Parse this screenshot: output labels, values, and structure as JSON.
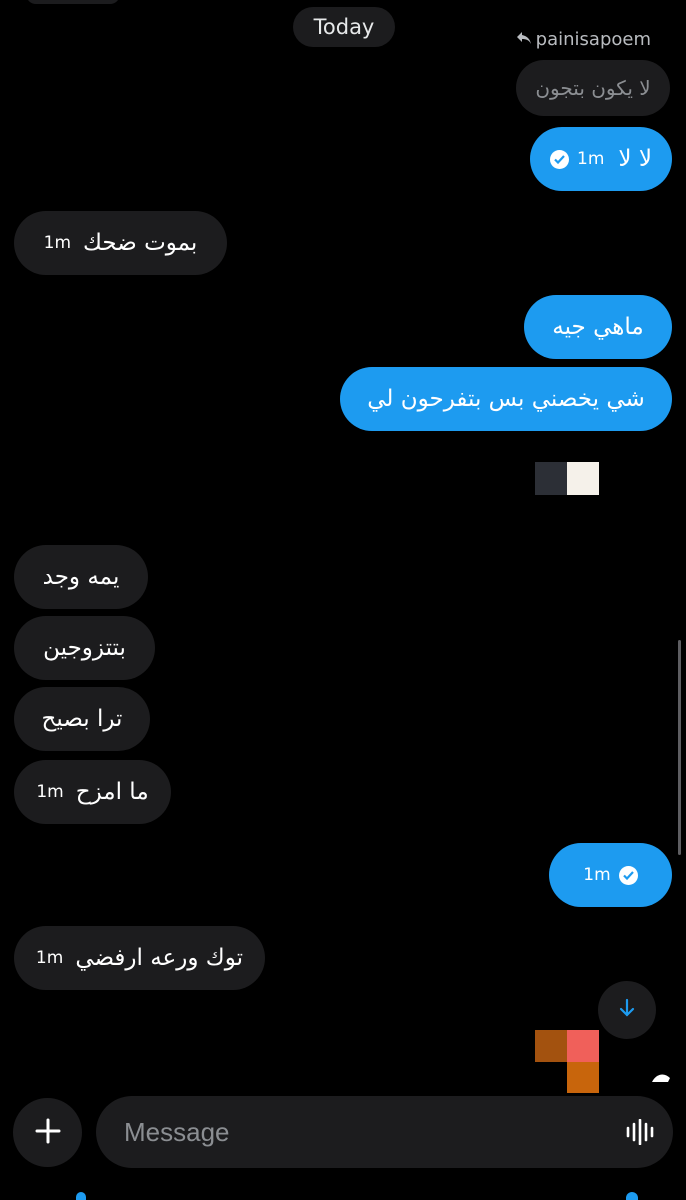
{
  "header": {
    "date_label": "Today",
    "reply_to_handle": "painisapoem",
    "reply_quote_text": "لا يكون بتجون"
  },
  "messages": [
    {
      "id": "m1",
      "direction": "outgoing",
      "text": "لا لا",
      "time": "1m",
      "status_icon": "check-circle-icon"
    },
    {
      "id": "m2",
      "direction": "incoming",
      "text": "بموت ضحك",
      "time": "1m"
    },
    {
      "id": "m3",
      "direction": "outgoing",
      "text": "ماهي جيه"
    },
    {
      "id": "m4",
      "direction": "outgoing",
      "text": "شي يخصني بس بتفرحون لي"
    },
    {
      "id": "m5",
      "direction": "incoming",
      "text": "يمه وجد"
    },
    {
      "id": "m6",
      "direction": "incoming",
      "text": "بتتزوجين"
    },
    {
      "id": "m7",
      "direction": "incoming",
      "text": "ترا بصيح"
    },
    {
      "id": "m8",
      "direction": "incoming",
      "text": "ما امزح",
      "time": "1m"
    },
    {
      "id": "m9",
      "direction": "outgoing",
      "text": "",
      "time": "1m",
      "status_icon": "check-circle-icon"
    },
    {
      "id": "m10",
      "direction": "incoming",
      "text": "توك ورعه ارفضي",
      "time": "1m"
    }
  ],
  "composer": {
    "placeholder": "Message",
    "add_icon": "plus-icon",
    "voice_icon": "voice-wave-icon"
  },
  "scroll_button_icon": "arrow-down-icon",
  "colors": {
    "outgoing_bubble": "#1d9bf0",
    "incoming_bubble": "#1c1c1e",
    "background": "#000000",
    "muted_text": "#8b8e92"
  }
}
